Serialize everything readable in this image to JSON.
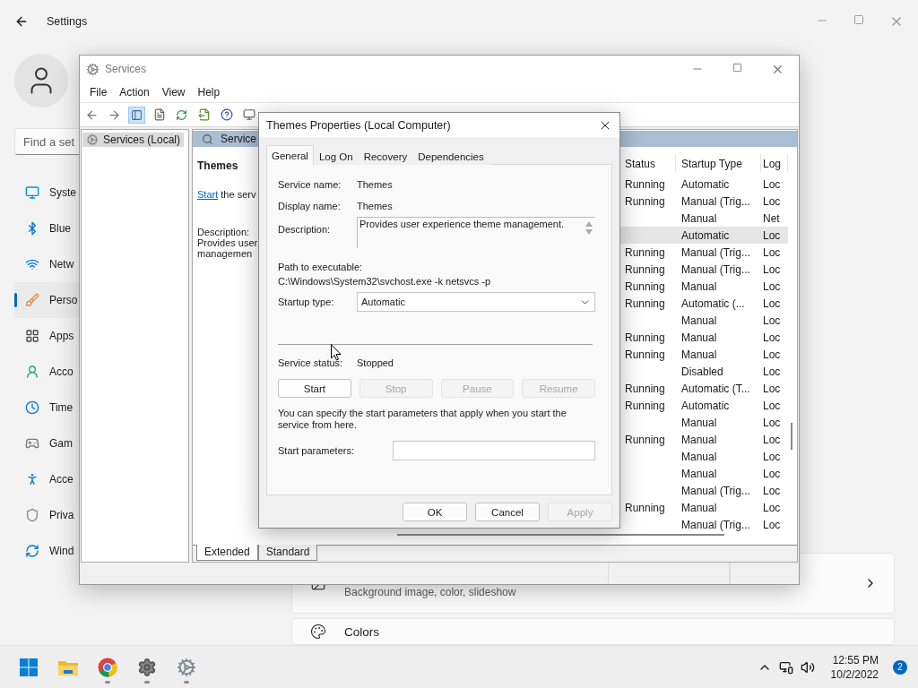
{
  "settings": {
    "title": "Settings",
    "search": {
      "placeholder": "Find a set"
    },
    "nav": [
      {
        "label": "Syste",
        "selected": false
      },
      {
        "label": "Blue",
        "selected": false
      },
      {
        "label": "Netw",
        "selected": false
      },
      {
        "label": "Perso",
        "selected": true
      },
      {
        "label": "Apps",
        "selected": false
      },
      {
        "label": "Acco",
        "selected": false
      },
      {
        "label": "Time",
        "selected": false
      },
      {
        "label": "Gam",
        "selected": false
      },
      {
        "label": "Acce",
        "selected": false
      },
      {
        "label": "Priva",
        "selected": false
      },
      {
        "label": "Wind",
        "selected": false
      }
    ],
    "cards": [
      {
        "subtitle": "Background image, color, slideshow"
      },
      {
        "title": "Colors"
      }
    ]
  },
  "services_window": {
    "title": "Services",
    "menu": [
      "File",
      "Action",
      "View",
      "Help"
    ],
    "tree": [
      {
        "label": "Services (Local)",
        "selected": true
      }
    ],
    "pane_header": "Service",
    "detail": {
      "name": "Themes",
      "link": "Start",
      "link_rest": " the serv",
      "description_label": "Description:",
      "description_lines": [
        "Provides user",
        "managemen"
      ]
    },
    "columns": [
      "Status",
      "Startup Type",
      "Log"
    ],
    "rows": [
      {
        "status": "Running",
        "startup": "Automatic",
        "log": "Loc",
        "selected": false
      },
      {
        "status": "Running",
        "startup": "Manual (Trig...",
        "log": "Loc",
        "selected": false
      },
      {
        "startup": "Manual",
        "log": "Net",
        "selected": false
      },
      {
        "startup": "Automatic",
        "log": "Loc",
        "selected": true
      },
      {
        "status": "Running",
        "startup": "Manual (Trig...",
        "log": "Loc",
        "selected": false
      },
      {
        "status": "Running",
        "startup": "Manual (Trig...",
        "log": "Loc",
        "selected": false
      },
      {
        "status": "Running",
        "startup": "Manual",
        "log": "Loc",
        "selected": false
      },
      {
        "status": "Running",
        "startup": "Automatic (...",
        "log": "Loc",
        "selected": false
      },
      {
        "startup": "Manual",
        "log": "Loc",
        "selected": false
      },
      {
        "status": "Running",
        "startup": "Manual",
        "log": "Loc",
        "selected": false
      },
      {
        "status": "Running",
        "startup": "Manual",
        "log": "Loc",
        "selected": false
      },
      {
        "startup": "Disabled",
        "log": "Loc",
        "selected": false
      },
      {
        "status": "Running",
        "startup": "Automatic (T...",
        "log": "Loc",
        "selected": false
      },
      {
        "status": "Running",
        "startup": "Automatic",
        "log": "Loc",
        "selected": false
      },
      {
        "startup": "Manual",
        "log": "Loc",
        "selected": false
      },
      {
        "status": "Running",
        "startup": "Manual",
        "log": "Loc",
        "selected": false
      },
      {
        "startup": "Manual",
        "log": "Loc",
        "selected": false
      },
      {
        "startup": "Manual",
        "log": "Loc",
        "selected": false
      },
      {
        "startup": "Manual (Trig...",
        "log": "Loc",
        "selected": false
      },
      {
        "status": "Running",
        "startup": "Manual",
        "log": "Loc",
        "selected": false
      },
      {
        "startup": "Manual (Trig...",
        "log": "Loc",
        "selected": false
      }
    ],
    "view_tabs": [
      {
        "label": "Extended",
        "selected": true
      },
      {
        "label": "Standard",
        "selected": false
      }
    ]
  },
  "dialog": {
    "title": "Themes Properties (Local Computer)",
    "tabs": [
      {
        "label": "General",
        "selected": true
      },
      {
        "label": "Log On",
        "selected": false
      },
      {
        "label": "Recovery",
        "selected": false
      },
      {
        "label": "Dependencies",
        "selected": false
      }
    ],
    "service_name_label": "Service name:",
    "service_name": "Themes",
    "display_name_label": "Display name:",
    "display_name": "Themes",
    "description_label": "Description:",
    "description": "Provides user experience theme management.",
    "path_label": "Path to executable:",
    "path": "C:\\Windows\\System32\\svchost.exe -k netsvcs -p",
    "startup_type_label": "Startup type:",
    "startup_type": "Automatic",
    "status_label": "Service status:",
    "status": "Stopped",
    "service_buttons": [
      {
        "label": "Start",
        "disabled": false
      },
      {
        "label": "Stop",
        "disabled": true
      },
      {
        "label": "Pause",
        "disabled": true
      },
      {
        "label": "Resume",
        "disabled": true
      }
    ],
    "params_note": "You can specify the start parameters that apply when you start the service from here.",
    "params_label": "Start parameters:",
    "footer_buttons": [
      {
        "label": "OK",
        "disabled": false
      },
      {
        "label": "Cancel",
        "disabled": false
      },
      {
        "label": "Apply",
        "disabled": true
      }
    ]
  },
  "taskbar": {
    "time": "12:55 PM",
    "date": "10/2/2022",
    "notifications": "2"
  }
}
